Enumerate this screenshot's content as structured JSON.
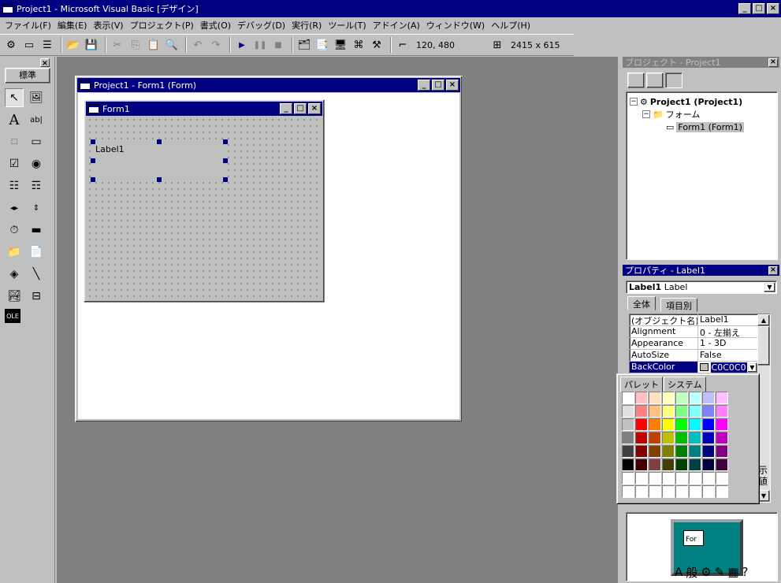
{
  "app": {
    "title": "Project1 - Microsoft Visual Basic [デザイン]"
  },
  "menu": [
    "ファイル(F)",
    "編集(E)",
    "表示(V)",
    "プロジェクト(P)",
    "書式(O)",
    "デバッグ(D)",
    "実行(R)",
    "ツール(T)",
    "アドイン(A)",
    "ウィンドウ(W)",
    "ヘルプ(H)"
  ],
  "toolbar": {
    "position": "120, 480",
    "size": "2415 x 615"
  },
  "toolbox": {
    "tab_label": "標準"
  },
  "form_designer": {
    "title": "Project1 - Form1 (Form)"
  },
  "form1": {
    "title": "Form1",
    "label_caption": "Label1"
  },
  "project_explorer": {
    "title": "プロジェクト - Project1",
    "tree": {
      "project": "Project1 (Project1)",
      "folder": "フォーム",
      "form": "Form1 (Form1)"
    }
  },
  "properties": {
    "title": "プロパティ - Label1",
    "object_name": "Label1",
    "object_type": "Label",
    "tabs": [
      "全体",
      "項目別"
    ],
    "rows": [
      {
        "name": "(オブジェクト名)",
        "value": "Label1"
      },
      {
        "name": "Alignment",
        "value": "0 - 左揃え"
      },
      {
        "name": "Appearance",
        "value": "1 - 3D"
      },
      {
        "name": "AutoSize",
        "value": "False"
      },
      {
        "name": "BackColor",
        "value": "C0C0C0"
      }
    ],
    "selected_row": "BackColor"
  },
  "palette": {
    "tabs": [
      "パレット",
      "システム"
    ],
    "colors": [
      "#ffffff",
      "#ffc0c0",
      "#ffe0c0",
      "#ffffc0",
      "#c0ffc0",
      "#c0ffff",
      "#c0c0ff",
      "#ffc0ff",
      "#e0e0e0",
      "#ff8080",
      "#ffc080",
      "#ffff80",
      "#80ff80",
      "#80ffff",
      "#8080ff",
      "#ff80ff",
      "#c0c0c0",
      "#ff0000",
      "#ff8000",
      "#ffff00",
      "#00ff00",
      "#00ffff",
      "#0000ff",
      "#ff00ff",
      "#808080",
      "#c00000",
      "#c04000",
      "#c0c000",
      "#00c000",
      "#00c0c0",
      "#0000c0",
      "#c000c0",
      "#404040",
      "#800000",
      "#804000",
      "#808000",
      "#008000",
      "#008080",
      "#000080",
      "#800080",
      "#000000",
      "#400000",
      "#804040",
      "#404000",
      "#004000",
      "#004040",
      "#000040",
      "#400040",
      "#ffffff",
      "#ffffff",
      "#ffffff",
      "#ffffff",
      "#ffffff",
      "#ffffff",
      "#ffffff",
      "#ffffff",
      "#ffffff",
      "#ffffff",
      "#ffffff",
      "#ffffff",
      "#ffffff",
      "#ffffff",
      "#ffffff",
      "#ffffff"
    ]
  },
  "layout": {
    "mini_form": "For"
  },
  "side_trunc": "示\n値",
  "lang_bar": {
    "ime": "A",
    "mode": "般"
  }
}
